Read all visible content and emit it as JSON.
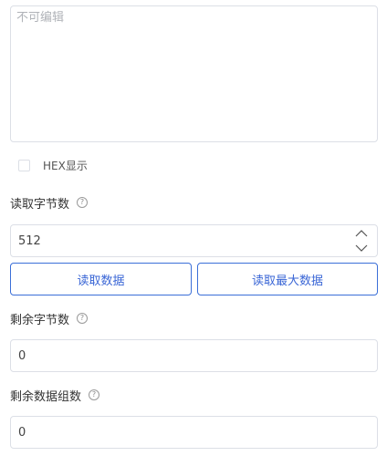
{
  "readonly_area": {
    "placeholder": "不可编辑"
  },
  "hex_toggle": {
    "label": "HEX显示",
    "checked": false
  },
  "read_bytes": {
    "label": "读取字节数",
    "value": "512"
  },
  "buttons": {
    "read_data": "读取数据",
    "read_max_data": "读取最大数据"
  },
  "remaining_bytes": {
    "label": "剩余字节数",
    "value": "0"
  },
  "remaining_groups": {
    "label": "剩余数据组数",
    "value": "0"
  },
  "help_icon_glyph": "?",
  "colors": {
    "accent": "#3b6fd8",
    "border": "#dcdfe6",
    "placeholder": "#b0b3b8"
  }
}
